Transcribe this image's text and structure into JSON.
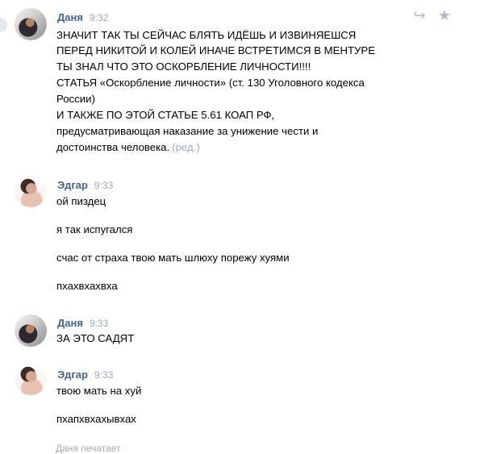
{
  "messages": [
    {
      "author": "Даня",
      "time": "9:32",
      "lines": [
        "ЗНАЧИТ ТАК ТЫ СЕЙЧАС БЛЯТЬ ИДЁШЬ И ИЗВИНЯЕШСЯ",
        "ПЕРЕД НИКИТОЙ И КОЛЕЙ ИНАЧЕ ВСТРЕТИМСЯ В МЕНТУРЕ",
        "ТЫ ЗНАЛ ЧТО ЭТО ОСКОРБЛЕНИЕ ЛИЧНОСТИ!!!!",
        "СТАТЬЯ «Оскорбление личности» (ст. 130 Уголовного кодекса",
        "России)",
        "И ТАКЖЕ ПО ЭТОЙ СТАТЬЕ 5.61 КОАП РФ,",
        "предусматривающая наказание за унижение чести и",
        "достоинства человека."
      ],
      "edited_label": "(ред.)",
      "actions": {
        "reply_icon": "reply-icon",
        "star_icon": "star-icon"
      }
    },
    {
      "author": "Эдгар",
      "time": "9:33",
      "lines": [
        "ой пиздец",
        "я так испугался",
        "счас от страха твою мать шлюху порежу хуями",
        "пхахвхахвха"
      ]
    },
    {
      "author": "Даня",
      "time": "9:33",
      "lines": [
        "ЗА ЭТО САДЯТ"
      ]
    },
    {
      "author": "Эдгар",
      "time": "9:33",
      "lines": [
        "твою мать на хуй",
        "пхапхвхахывхах"
      ]
    }
  ],
  "typing": {
    "text": "Даня печатает"
  }
}
